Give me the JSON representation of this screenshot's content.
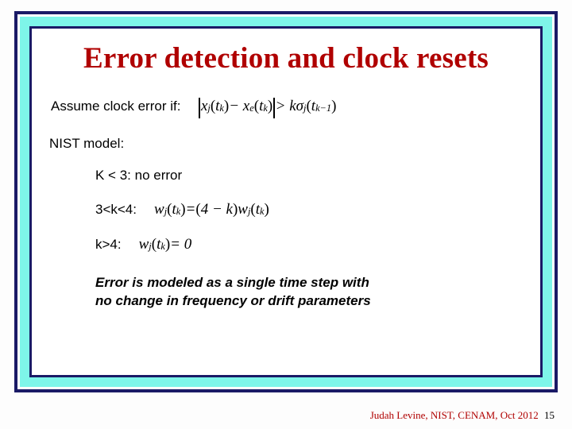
{
  "title": "Error detection and clock resets",
  "assume_label": "Assume clock error if:",
  "nist_label": "NIST model:",
  "cond1": "K < 3: no error",
  "cond2_label": "3<k<4:",
  "cond3_label": "k>4:",
  "formula_assume_html": "|x_j(t_k) − x_e(t_k)| > kσ_j(t_{k−1})",
  "formula_cond2_html": "w_j(t_k) = (4−k)w_j(t_k)",
  "formula_cond3_html": "w_j(t_k) = 0",
  "conclusion_line1": "Error is modeled as a single time step with",
  "conclusion_line2": "no change in frequency or drift parameters",
  "footer_text": "Judah Levine, NIST, CENAM, Oct 2012",
  "page_number": "15"
}
